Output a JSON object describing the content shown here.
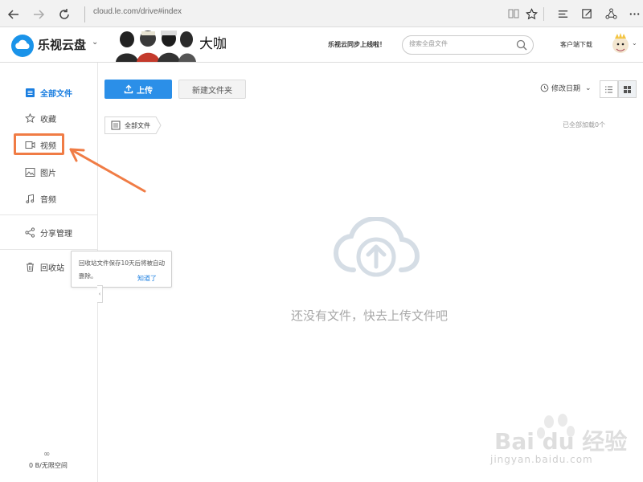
{
  "browser": {
    "address": "cloud.le.com/drive#index"
  },
  "header": {
    "logo_text": "乐视云盘",
    "banner_text": "大咖",
    "promo": "乐视云同步上线啦！",
    "search_placeholder": "搜索全盘文件",
    "client_download": "客户端下载"
  },
  "sidebar": {
    "items": [
      {
        "label": "全部文件",
        "icon": "file-list-icon",
        "active": true
      },
      {
        "label": "收藏",
        "icon": "star-icon"
      },
      {
        "label": "视频",
        "icon": "video-icon"
      },
      {
        "label": "图片",
        "icon": "image-icon"
      },
      {
        "label": "音频",
        "icon": "music-icon"
      },
      {
        "label": "分享管理",
        "icon": "share-icon"
      },
      {
        "label": "回收站",
        "icon": "trash-icon"
      }
    ],
    "storage_symbol": "∞",
    "storage": "0 B/无限空间"
  },
  "tooltip": {
    "text": "回收站文件保存10天后将被自动删除。",
    "ok": "知道了"
  },
  "toolbar": {
    "upload": "上传",
    "new_folder": "新建文件夹",
    "sort": "修改日期"
  },
  "breadcrumb": {
    "root": "全部文件"
  },
  "status": {
    "loaded": "已全部加载0个"
  },
  "empty": {
    "text": "还没有文件，快去上传文件吧"
  },
  "watermark": {
    "text": "Bai du 经验",
    "sub": "jingyan.baidu.com"
  },
  "colors": {
    "accent": "#2b8fe8",
    "annotation": "#f07c45"
  }
}
